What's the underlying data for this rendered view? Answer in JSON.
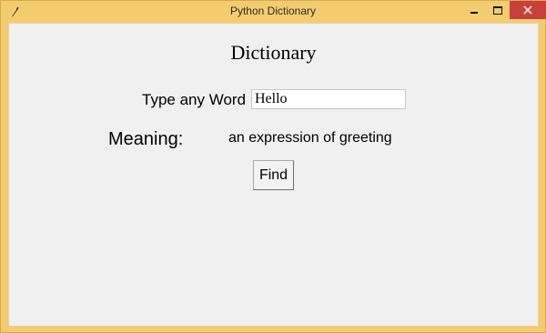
{
  "window": {
    "title": "Python Dictionary",
    "icons": {
      "app": "feather-icon",
      "minimize": "minimize-icon",
      "maximize": "maximize-icon",
      "close": "close-icon"
    },
    "colors": {
      "frame": "#f4cc70",
      "close_button": "#c7403a",
      "client_bg": "#f0f0f0"
    }
  },
  "main": {
    "heading": "Dictionary",
    "word_label": "Type any Word",
    "word_value": "Hello",
    "meaning_label": "Meaning:",
    "meaning_value": "an expression of greeting",
    "find_label": "Find"
  }
}
